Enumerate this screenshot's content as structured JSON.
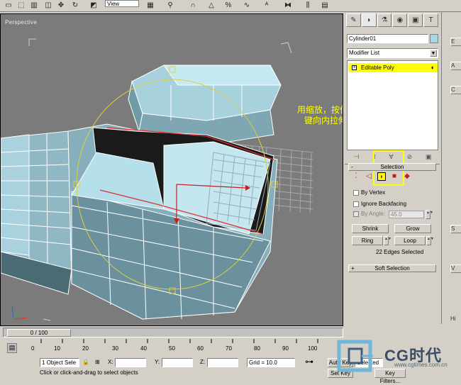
{
  "toolbar": {
    "view_dropdown": "View",
    "icons": [
      "select-region-icon",
      "window-crossing-icon",
      "move-icon",
      "rotate-icon",
      "scale-icon",
      "reference-coordinate-icon",
      "pivot-icon",
      "select-and-link-icon",
      "mirror-icon",
      "align-icon",
      "snap-icon",
      "angle-snap-icon",
      "percent-snap-icon",
      "spinner-snap-icon",
      "named-selection-icon"
    ]
  },
  "viewport": {
    "label": "Perspective",
    "note_line1": "用缩放，按住shift",
    "note_line2": "键向内拉伸。"
  },
  "command_panel": {
    "tabs": [
      "create-tab",
      "modify-tab",
      "hierarchy-tab",
      "motion-tab",
      "display-tab",
      "utilities-tab"
    ],
    "object_name": "Cylinder01",
    "object_color": "#a5d8e6",
    "modifier_list": "Modifier List",
    "stack_item": "Editable Poly",
    "selection_rollout": "Selection",
    "by_vertex": "By Vertex",
    "ignore_backfacing": "Ignore Backfacing",
    "by_angle": "By Angle:",
    "by_angle_value": "45.0",
    "shrink": "Shrink",
    "grow": "Grow",
    "ring": "Ring",
    "loop": "Loop",
    "edges_selected": "22 Edges Selected",
    "soft_selection": "Soft Selection",
    "rollout_minus": "-",
    "rollout_plus": "+"
  },
  "right_strip": {
    "items": [
      "E",
      "A",
      "C",
      "S",
      "V",
      "Hi"
    ]
  },
  "timeline": {
    "slider": "0 / 100",
    "ticks": [
      "0",
      "10",
      "20",
      "30",
      "40",
      "50",
      "60",
      "70",
      "80",
      "90",
      "100"
    ]
  },
  "status": {
    "objects": "1 Object Sele",
    "x_label": "X:",
    "y_label": "Y:",
    "z_label": "Z:",
    "grid": "Grid = 10.0",
    "prompt": "Click or click-and-drag to select objects",
    "auto_key": "Auto Key",
    "selected": "Selected",
    "set_key": "Set Key",
    "key_filters": "Key Filters..."
  },
  "logo": {
    "text": "CG时代",
    "url": "www.cgtimes.com.cn"
  }
}
